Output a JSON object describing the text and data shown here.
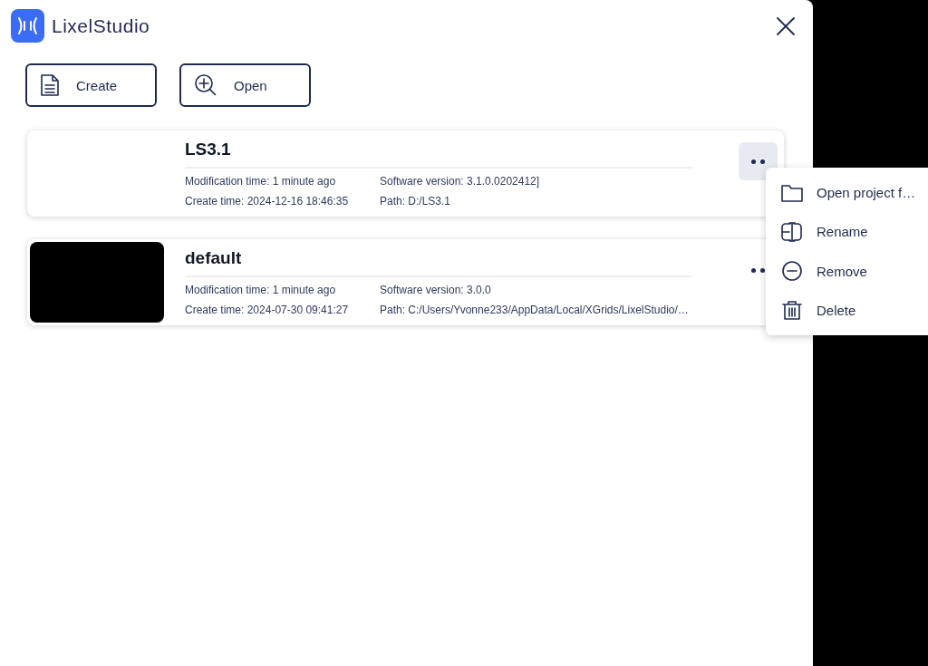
{
  "app": {
    "name": "LixelStudio"
  },
  "actions": [
    {
      "kind": "create",
      "label": "Create"
    },
    {
      "kind": "open",
      "label": "Open"
    }
  ],
  "projects": [
    {
      "name": "LS3.1",
      "has_thumbnail": false,
      "menu_open": true,
      "modification": "Modification time: 1 minute ago",
      "created": "Create time: 2024-12-16 18:46:35",
      "version": "Software version: 3.1.0.0202412]",
      "path": "Path: D:/LS3.1"
    },
    {
      "name": "default",
      "has_thumbnail": true,
      "menu_open": false,
      "modification": "Modification time: 1 minute ago",
      "created": "Create time: 2024-07-30 09:41:27",
      "version": "Software version: 3.0.0",
      "path": "Path: C:/Users/Yvonne233/AppData/Local/XGrids/LixelStudio/…"
    }
  ],
  "context_menu": [
    {
      "kind": "folder",
      "label": "Open project f…"
    },
    {
      "kind": "rename",
      "label": "Rename"
    },
    {
      "kind": "remove",
      "label": "Remove"
    },
    {
      "kind": "delete",
      "label": "Delete"
    }
  ]
}
